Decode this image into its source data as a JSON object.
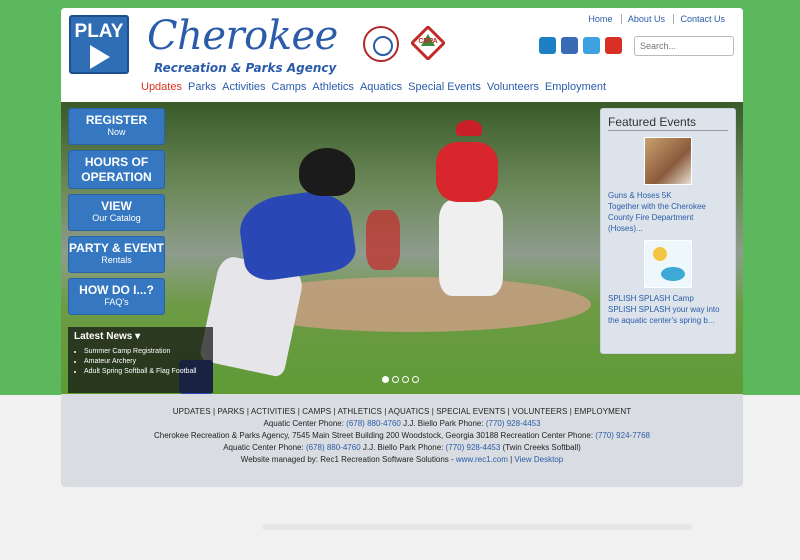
{
  "header": {
    "play_logo": "PLAY",
    "brand_title": "Cherokee",
    "brand_subtitle": "Recreation & Parks Agency",
    "crpa_badge": "CRPA",
    "top_links": [
      "Home",
      "About Us",
      "Contact Us"
    ],
    "social_icons": [
      "instagram-icon",
      "facebook-icon",
      "twitter-icon",
      "youtube-icon"
    ],
    "search_placeholder": "Search..."
  },
  "nav": {
    "items": [
      "Updates",
      "Parks",
      "Activities",
      "Camps",
      "Athletics",
      "Aquatics",
      "Special Events",
      "Volunteers",
      "Employment"
    ],
    "active_color": "#d9341e",
    "link_color": "#2a5caa"
  },
  "hero": {
    "buttons": [
      {
        "line1": "REGISTER",
        "line2": "Now"
      },
      {
        "line1": "HOURS OF",
        "line2": "OPERATION"
      },
      {
        "line1": "VIEW",
        "line2": "Our Catalog"
      },
      {
        "line1": "PARTY & EVENT",
        "line2": "Rentals"
      },
      {
        "line1": "HOW DO I...?",
        "line2": "FAQ's"
      }
    ],
    "latest_news": {
      "title": "Latest News ▾",
      "items": [
        "Summer Camp Registration",
        "Amateur Archery",
        "Adult Spring Softball & Flag Football"
      ]
    },
    "slide_dots": 4,
    "active_slide": 1
  },
  "featured": {
    "title": "Featured Events",
    "events": [
      {
        "title": "Guns & Hoses 5K",
        "desc": "Together with the Cherokee County Fire Department (Hoses)..."
      },
      {
        "title": "SPLISH SPLASH Camp",
        "desc": "SPLISH SPLASH your way into the aquatic center's spring b..."
      }
    ]
  },
  "footer": {
    "nav": "UPDATES | PARKS | ACTIVITIES | CAMPS | ATHLETICS | AQUATICS | SPECIAL EVENTS | VOLUNTEERS | EMPLOYMENT",
    "line1_a": "Aquatic Center Phone: ",
    "line1_p1": "(678) 880-4760",
    "line1_b": " J.J. Biello Park Phone: ",
    "line1_p2": "(770) 928-4453",
    "line2_a": "Cherokee Recreation & Parks Agency, 7545 Main Street Building 200 Woodstock, Georgia 30188 Recreation Center Phone: ",
    "line2_p": "(770) 924-7768",
    "line3_a": "Aquatic Center Phone: ",
    "line3_p1": "(678) 880-4760",
    "line3_b": " J.J. Biello Park Phone: ",
    "line3_p2": "(770) 928-4453",
    "line3_c": " (Twin Creeks Softball)",
    "line4_a": "Website managed by: Rec1 Recreation Software Solutions - ",
    "line4_link1": "www.rec1.com",
    "line4_sep": " | ",
    "line4_link2": "View Desktop"
  },
  "colors": {
    "page_green": "#5cb85c",
    "brand_blue": "#2a5caa",
    "button_blue": "#3577c0"
  }
}
